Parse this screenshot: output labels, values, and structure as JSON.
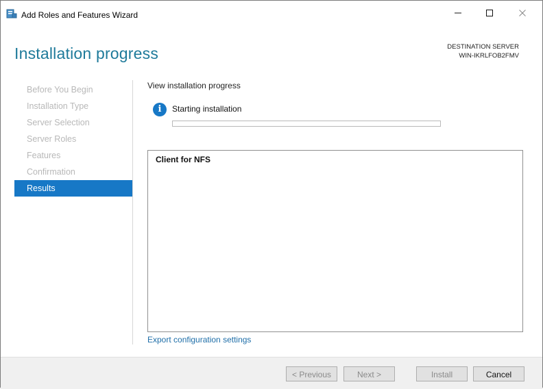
{
  "window": {
    "title": "Add Roles and Features Wizard",
    "controls": {
      "minimize": "minimize-icon",
      "maximize": "maximize-icon",
      "close": "close-icon"
    }
  },
  "header": {
    "page_title": "Installation progress",
    "destination_label": "DESTINATION SERVER",
    "destination_server": "WIN-IKRLFOB2FMV"
  },
  "nav": {
    "items": [
      {
        "label": "Before You Begin",
        "active": false
      },
      {
        "label": "Installation Type",
        "active": false
      },
      {
        "label": "Server Selection",
        "active": false
      },
      {
        "label": "Server Roles",
        "active": false
      },
      {
        "label": "Features",
        "active": false
      },
      {
        "label": "Confirmation",
        "active": false
      },
      {
        "label": "Results",
        "active": true
      }
    ]
  },
  "content": {
    "section_title": "View installation progress",
    "status_icon": "info-icon",
    "status_text": "Starting installation",
    "progress_fraction": 0,
    "features": [
      "Client for NFS"
    ],
    "export_link": "Export configuration settings"
  },
  "footer": {
    "previous_label": "< Previous",
    "next_label": "Next >",
    "install_label": "Install",
    "cancel_label": "Cancel"
  },
  "colors": {
    "accent": "#1778c6",
    "title": "#1e7a9a",
    "link": "#1e6ea8"
  }
}
